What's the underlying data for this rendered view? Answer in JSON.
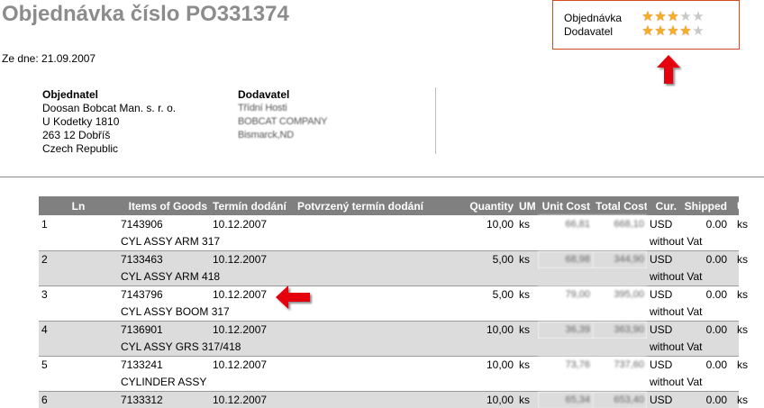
{
  "title": "Objednávka číslo PO331374",
  "date_line": "Ze dne: 21.09.2007",
  "buyer": {
    "heading": "Objednatel",
    "lines": [
      "Doosan Bobcat Man. s. r. o.",
      "U Kodetky 1810",
      "263 12 Dobříš",
      "Czech Republic"
    ]
  },
  "supplier": {
    "heading": "Dodavatel",
    "lines": [
      "Třídní Hosti",
      "BOBCAT COMPANY",
      "Bismarck,ND"
    ]
  },
  "rating": {
    "label_order": "Objednávka",
    "label_supplier": "Dodavatel",
    "order_stars": 3,
    "supplier_stars": 4,
    "max_stars": 5,
    "star_color": "#f2b01e",
    "border_color": "#d64a1f"
  },
  "arrow_color": "#e4000f",
  "table": {
    "headers": [
      "Ln",
      "Items of Goods",
      "Termín dodání",
      "Potvrzený termín dodání",
      "Quantity",
      "UM",
      "Unit Cost",
      "Total Cost",
      "Cur.",
      "Shipped",
      "UM"
    ],
    "rows": [
      {
        "ln": "1",
        "item": "7143906",
        "desc": "CYL ASSY ARM 317",
        "date": "10.12.2007",
        "confirmed": "",
        "qty": "10,00",
        "um": "ks",
        "unit_cost": "66,81",
        "total_cost": "668,10",
        "cur": "USD",
        "vat": "without Vat",
        "shipped": "0.00",
        "um2": "ks"
      },
      {
        "ln": "2",
        "item": "7133463",
        "desc": "CYL ASSY ARM 418",
        "date": "10.12.2007",
        "confirmed": "",
        "qty": "5,00",
        "um": "ks",
        "unit_cost": "68,98",
        "total_cost": "344,90",
        "cur": "USD",
        "vat": "without Vat",
        "shipped": "0.00",
        "um2": "ks"
      },
      {
        "ln": "3",
        "item": "7143796",
        "desc": "CYL ASSY BOOM 317",
        "date": "10.12.2007",
        "confirmed": "",
        "qty": "5,00",
        "um": "ks",
        "unit_cost": "79,00",
        "total_cost": "395,00",
        "cur": "USD",
        "vat": "without Vat",
        "shipped": "0.00",
        "um2": "ks"
      },
      {
        "ln": "4",
        "item": "7136901",
        "desc": "CYL ASSY GRS 317/418",
        "date": "10.12.2007",
        "confirmed": "",
        "qty": "10,00",
        "um": "ks",
        "unit_cost": "36,39",
        "total_cost": "363,90",
        "cur": "USD",
        "vat": "without Vat",
        "shipped": "0.00",
        "um2": "ks"
      },
      {
        "ln": "5",
        "item": "7133241",
        "desc": "CYLINDER ASSY",
        "date": "10.12.2007",
        "confirmed": "",
        "qty": "10,00",
        "um": "ks",
        "unit_cost": "73,76",
        "total_cost": "737,60",
        "cur": "USD",
        "vat": "without Vat",
        "shipped": "0.00",
        "um2": "ks"
      },
      {
        "ln": "6",
        "item": "7133312",
        "desc": "",
        "date": "10.12.2007",
        "confirmed": "",
        "qty": "10,00",
        "um": "ks",
        "unit_cost": "65,34",
        "total_cost": "653,40",
        "cur": "USD",
        "vat": "",
        "shipped": "0.00",
        "um2": "ks"
      }
    ]
  }
}
